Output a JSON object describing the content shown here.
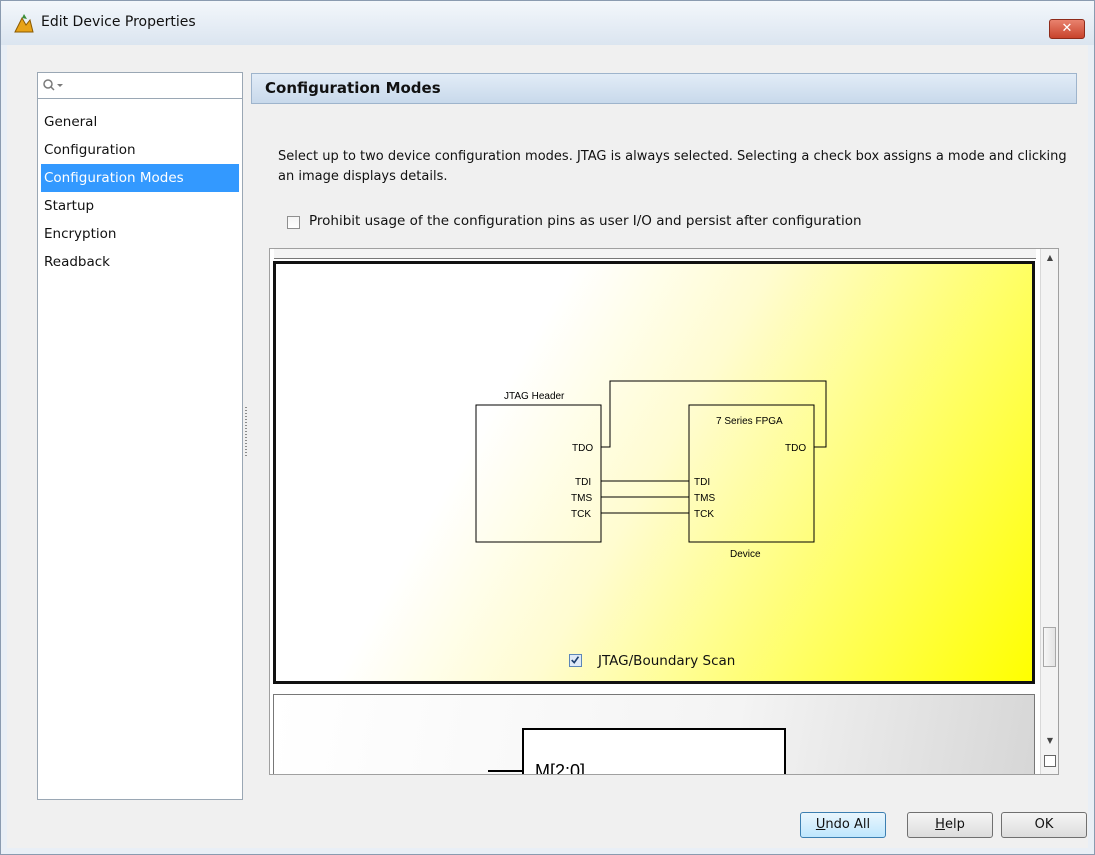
{
  "window": {
    "title": "Edit Device Properties",
    "close_label": "✕"
  },
  "sidebar": {
    "search_placeholder": "",
    "items": [
      {
        "label": "General"
      },
      {
        "label": "Configuration"
      },
      {
        "label": "Configuration Modes",
        "selected": true
      },
      {
        "label": "Startup"
      },
      {
        "label": "Encryption"
      },
      {
        "label": "Readback"
      }
    ]
  },
  "panel": {
    "title": "Configuration Modes",
    "description": "Select up to two device configuration modes. JTAG is always selected. Selecting a check box assigns a mode and clicking an image displays details.",
    "prohibit_label": "Prohibit usage of the configuration pins as user I/O and persist after configuration",
    "prohibit_checked": false
  },
  "jtag_mode": {
    "label": "JTAG/Boundary Scan",
    "checked": true,
    "diagram": {
      "header_title": "JTAG Header",
      "fpga_title": "7 Series FPGA",
      "device_label": "Device",
      "header_pins": [
        "TDO",
        "TDI",
        "TMS",
        "TCK"
      ],
      "fpga_pins": [
        "TDI",
        "TMS",
        "TCK"
      ],
      "fpga_out_pin": "TDO"
    }
  },
  "next_mode": {
    "pin_label": "M[2:0]"
  },
  "buttons": {
    "undo_u": "U",
    "undo_rest": "ndo All",
    "help_u": "H",
    "help_rest": "elp",
    "ok": "OK"
  },
  "colors": {
    "selection": "#3399ff",
    "card_highlight": "#ffff00",
    "header_bg": "#c8d9eb"
  }
}
